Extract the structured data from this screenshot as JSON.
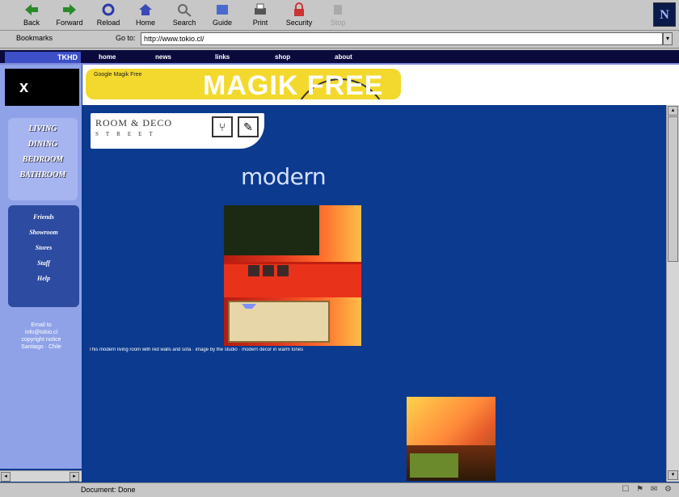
{
  "toolbar": {
    "back": "Back",
    "forward": "Forward",
    "reload": "Reload",
    "home": "Home",
    "search": "Search",
    "guide": "Guide",
    "print": "Print",
    "security": "Security",
    "stop": "Stop",
    "logo": "N"
  },
  "location": {
    "bookmarks": "Bookmarks",
    "goto": "Go to:",
    "url": "http://www.tokio.cl/"
  },
  "site": {
    "brand": "TKHD",
    "nav": [
      "home",
      "news",
      "links",
      "shop",
      "about"
    ],
    "banner_small": "Google Magik Free",
    "banner_big": "MAGIK FREE",
    "x_label": "x"
  },
  "sidebar": {
    "categories": [
      "LIVING",
      "DINING",
      "BEDROOM",
      "BATHROOM"
    ],
    "links": [
      "Friends",
      "Showroom",
      "Stores",
      "Staff",
      "Help"
    ],
    "footer": [
      "Email to",
      "info@tokio.cl",
      "copyright notice",
      "Santiago · Chile"
    ]
  },
  "room": {
    "title": "ROOM & DECO",
    "subtitle": "STREET",
    "icon1": "chair",
    "icon2": "brush"
  },
  "heading": "modern",
  "caption": "This modern living room with red walls and sofa · image by the studio · modern decor in warm tones",
  "status": "Document: Done",
  "status_icons": "☐ ⚑ ✉ ⚙"
}
